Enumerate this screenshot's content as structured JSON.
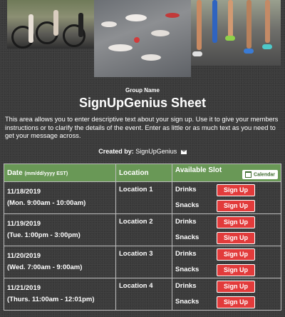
{
  "header": {
    "group_name": "Group Name",
    "title": "SignUpGenius Sheet",
    "description": "This area allows you to enter descriptive text about your sign up. Use it to give your members instructions or to clarify the details of the event. Enter as little or as much text as you need to get your message across.",
    "created_by_label": "Created by:",
    "created_by_name": "SignUpGenius"
  },
  "table": {
    "col_date": "Date",
    "col_date_format": "(mm/dd/yyyy EST)",
    "col_location": "Location",
    "col_slot": "Available Slot",
    "calendar_label": "Calendar",
    "signup_label": "Sign Up",
    "rows": [
      {
        "date": "11/18/2019",
        "time": "(Mon. 9:00am - 10:00am)",
        "location": "Location 1",
        "slots": [
          "Drinks",
          "Snacks"
        ]
      },
      {
        "date": "11/19/2019",
        "time": "(Tue. 1:00pm - 3:00pm)",
        "location": "Location 2",
        "slots": [
          "Drinks",
          "Snacks"
        ]
      },
      {
        "date": "11/20/2019",
        "time": "(Wed. 7:00am - 9:00am)",
        "location": "Location 3",
        "slots": [
          "Drinks",
          "Snacks"
        ]
      },
      {
        "date": "11/21/2019",
        "time": "(Thurs. 11:00am - 12:01pm)",
        "location": "Location 4",
        "slots": [
          "Drinks",
          "Snacks"
        ]
      }
    ]
  },
  "colors": {
    "header_green": "#699856",
    "signup_red": "#e23b3b",
    "background": "#3b3b3b"
  },
  "icons": {
    "mail": "envelope-icon",
    "calendar": "calendar-icon"
  }
}
